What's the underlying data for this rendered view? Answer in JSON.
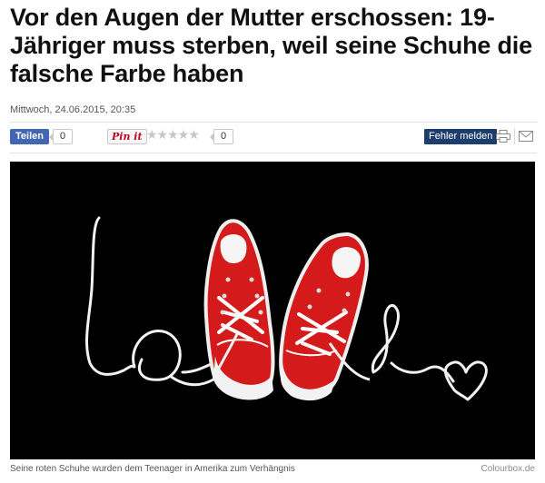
{
  "article": {
    "headline": "Vor den Augen der Mutter erschossen: 19-Jähriger muss sterben, weil seine Schuhe die falsche Farbe haben",
    "date": "Mittwoch, 24.06.2015, 20:35"
  },
  "share_bar": {
    "facebook_label": "Teilen",
    "facebook_count": "0",
    "pinterest_label": "Pin it",
    "rating_stars": "★★★★★",
    "rating_count": "0",
    "report_label": "Fehler melden",
    "icons": [
      "print-icon",
      "mail-icon"
    ]
  },
  "image": {
    "caption": "Seine roten Schuhe wurden dem Teenager in Amerika zum Verhängnis",
    "credit": "Colourbox.de"
  },
  "colors": {
    "facebook": "#4267b2",
    "report_button": "#1d3d6e",
    "pinterest": "#bd081c",
    "shoe_red": "#d41a1a"
  }
}
